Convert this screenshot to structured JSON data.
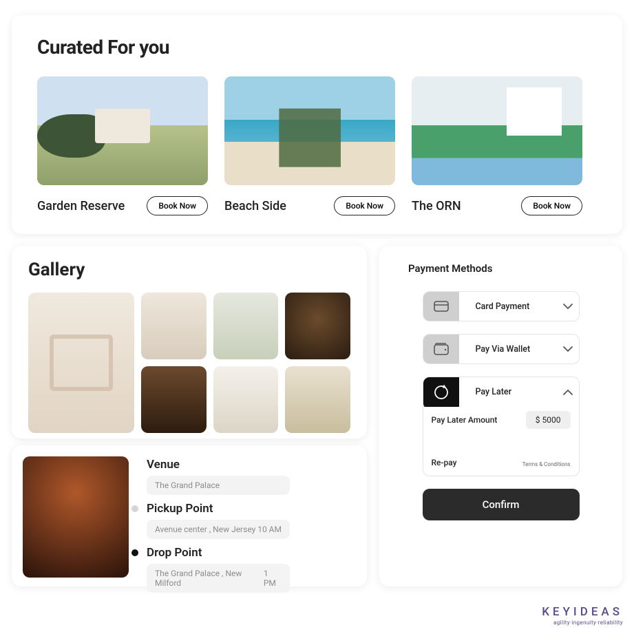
{
  "curated": {
    "heading": "Curated For you",
    "items": [
      {
        "title": "Garden Reserve",
        "cta": "Book Now",
        "scene": "garden"
      },
      {
        "title": "Beach Side",
        "cta": "Book Now",
        "scene": "beach"
      },
      {
        "title": "The ORN",
        "cta": "Book Now",
        "scene": "orn"
      }
    ]
  },
  "gallery": {
    "heading": "Gallery"
  },
  "venue": {
    "label_venue": "Venue",
    "value_venue": "The Grand Palace",
    "label_pickup": "Pickup  Point",
    "value_pickup": "Avenue center , New Jersey",
    "time_pickup": "10 AM",
    "label_drop": "Drop  Point",
    "value_drop": "The Grand Palace , New Milford",
    "time_drop": "1 PM"
  },
  "payment": {
    "heading": "Payment Methods",
    "methods": {
      "card": "Card Payment",
      "wallet": "Pay Via Wallet",
      "later": "Pay Later"
    },
    "later_panel": {
      "amount_label": "Pay Later Amount",
      "amount_value": "$ 5000",
      "repay": "Re-pay",
      "tnc": "Terms & Conditions"
    },
    "confirm": "Confirm"
  },
  "brand": {
    "name": "KEYIDEAS",
    "tag": "agility·ingenuity·reliability"
  }
}
